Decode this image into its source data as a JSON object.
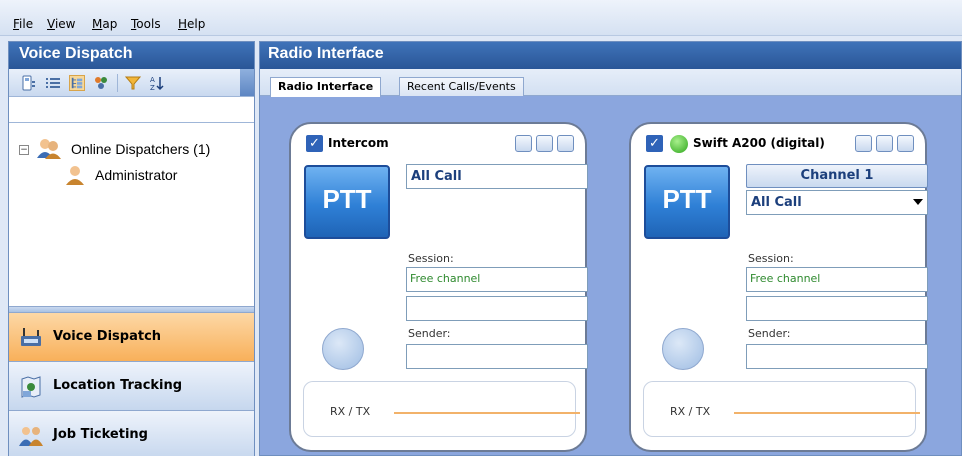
{
  "menu": {
    "items": [
      "File",
      "View",
      "Map",
      "Tools",
      "Help"
    ]
  },
  "left_panel": {
    "title": "Voice Dispatch",
    "toolbar_icons": [
      "device-list-icon",
      "list-view-icon",
      "tree-view-icon",
      "group-icon",
      "filter-icon",
      "sort-icon"
    ],
    "tree": {
      "group_label": "Online Dispatchers (1)",
      "items": [
        "Administrator"
      ]
    },
    "nav": [
      {
        "label": "Voice Dispatch",
        "icon": "voice-dispatch-icon",
        "active": true
      },
      {
        "label": "Location Tracking",
        "icon": "location-tracking-icon",
        "active": false
      },
      {
        "label": "Job Ticketing",
        "icon": "job-ticketing-icon",
        "active": false
      }
    ]
  },
  "right_panel": {
    "title": "Radio Interface",
    "tabs": [
      {
        "label": "Radio Interface",
        "active": true
      },
      {
        "label": "Recent Calls/Events",
        "active": false
      }
    ],
    "cards": [
      {
        "name": "Intercom",
        "checked": true,
        "ptt_label": "PTT",
        "target": "All Call",
        "session_label": "Session:",
        "session_value": "Free channel",
        "sender_label": "Sender:",
        "sender_value": "",
        "rxtx_label": "RX / TX"
      },
      {
        "name": "Swift A200 (digital)",
        "checked": true,
        "status_color": "#2ea61c",
        "ptt_label": "PTT",
        "channel_button": "Channel 1",
        "target": "All Call",
        "session_label": "Session:",
        "session_value": "Free channel",
        "sender_label": "Sender:",
        "sender_value": "",
        "rxtx_label": "RX / TX"
      }
    ]
  },
  "colors": {
    "accent": "#2a5697",
    "active_nav": "#f8b05a",
    "panel_bg": "#8ba6de"
  }
}
